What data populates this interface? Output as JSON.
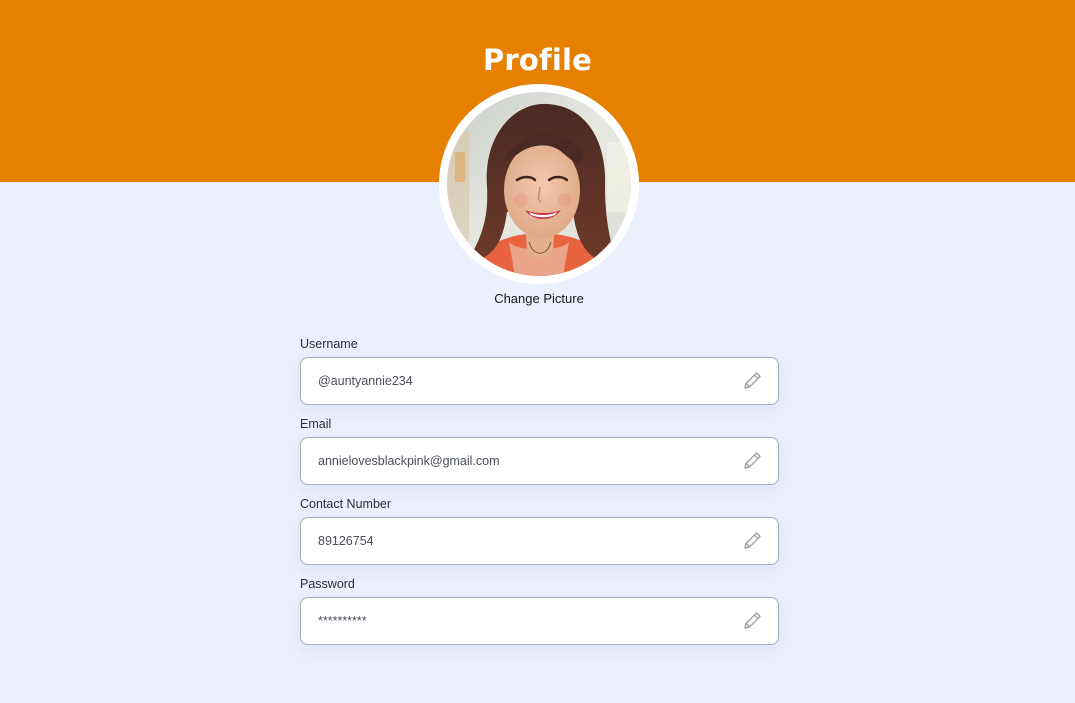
{
  "header": {
    "title": "Profile",
    "color": "#E68000"
  },
  "profile": {
    "avatar_alt": "avatar-photo",
    "change_picture_label": "Change Picture"
  },
  "form": {
    "fields": [
      {
        "label": "Username",
        "value": "@auntyannie234",
        "icon": "pencil-icon"
      },
      {
        "label": "Email",
        "value": "annielovesblackpink@gmail.com",
        "icon": "pencil-icon"
      },
      {
        "label": "Contact Number",
        "value": "89126754",
        "icon": "pencil-icon"
      },
      {
        "label": "Password",
        "value": "**********",
        "icon": "pencil-icon"
      }
    ]
  },
  "colors": {
    "background": "#ECEFFE",
    "accent": "#E68000",
    "field_border": "#A9ADBB"
  }
}
